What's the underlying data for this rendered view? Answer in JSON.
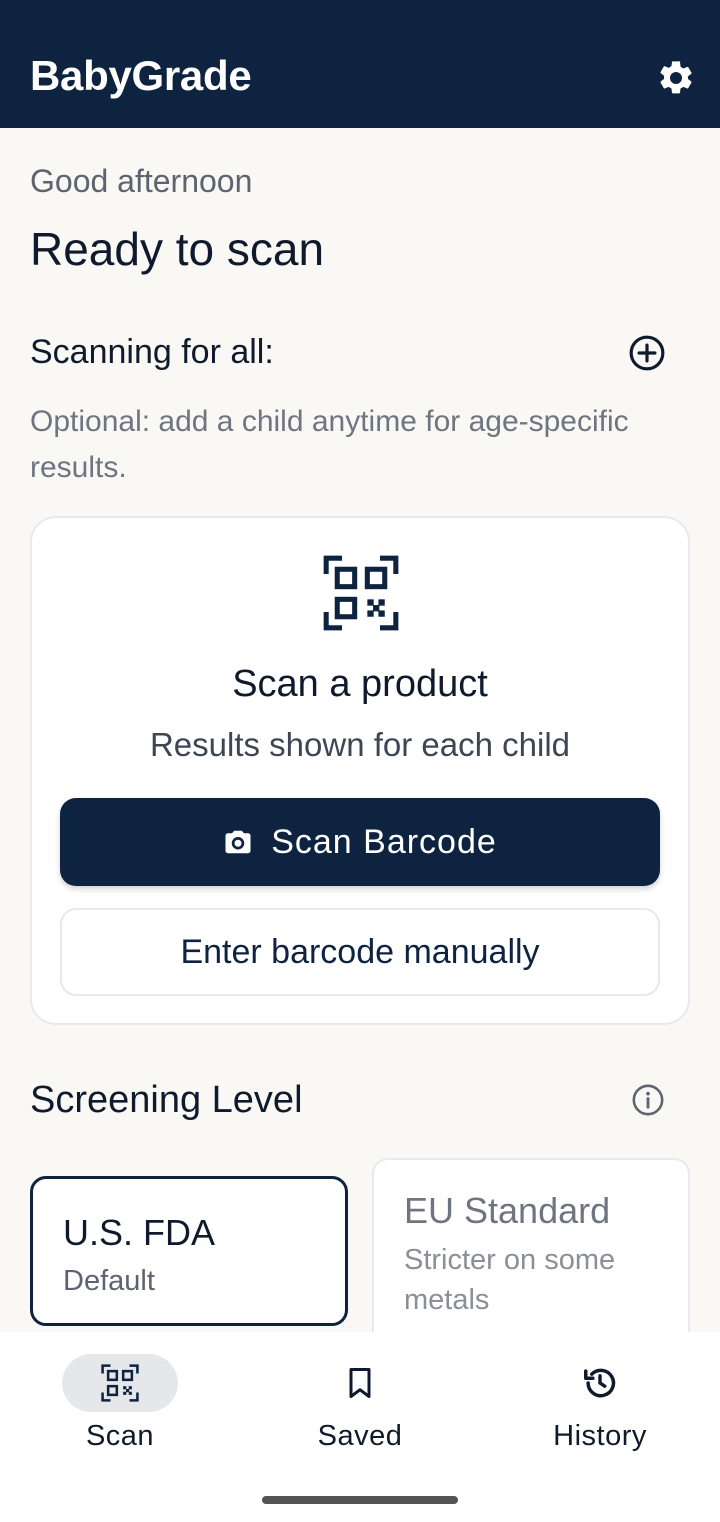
{
  "header": {
    "title": "BabyGrade",
    "settings_icon": "gear-icon"
  },
  "greeting": "Good afternoon",
  "page_title": "Ready to scan",
  "scanning_for": {
    "label": "Scanning for all:",
    "add_icon": "plus-circle-icon"
  },
  "hint": "Optional: add a child anytime for age-specific results.",
  "scan_card": {
    "icon": "qr-code-icon",
    "title": "Scan a product",
    "subtitle": "Results shown for each child",
    "primary_button": "Scan Barcode",
    "primary_icon": "camera-icon",
    "secondary_button": "Enter barcode manually"
  },
  "screening": {
    "title": "Screening Level",
    "info_icon": "info-icon",
    "options": [
      {
        "name": "U.S. FDA",
        "desc": "Default",
        "selected": true
      },
      {
        "name": "EU Standard",
        "desc": "Stricter on some metals",
        "selected": false
      }
    ]
  },
  "nav": [
    {
      "label": "Scan",
      "icon": "qr-code-icon",
      "active": true
    },
    {
      "label": "Saved",
      "icon": "bookmark-icon",
      "active": false
    },
    {
      "label": "History",
      "icon": "history-icon",
      "active": false
    }
  ],
  "colors": {
    "navy": "#0e2340",
    "background": "#f9f8f5",
    "muted": "#6f7580"
  }
}
